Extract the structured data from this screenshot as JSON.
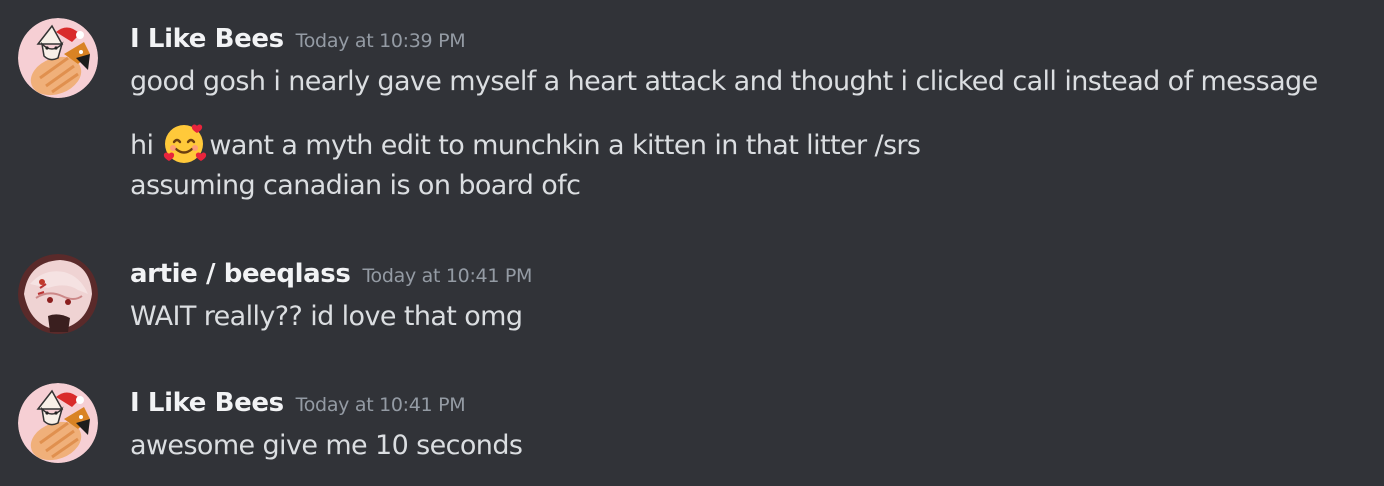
{
  "chat": {
    "messages": [
      {
        "author": "I Like Bees",
        "timestamp": "Today at 10:39 PM",
        "avatar_icon": "fox-with-santa-hat-avatar",
        "lines": [
          "good gosh i nearly gave myself a heart attack and thought i clicked call instead of message",
          "want a myth edit to munchkin a kitten in that litter /srs",
          "assuming canadian is on board ofc"
        ],
        "line2_prefix": "hi",
        "emoji": "smiling-face-with-hearts-emoji"
      },
      {
        "author": "artie / beeqlass",
        "timestamp": "Today at 10:41 PM",
        "avatar_icon": "anime-character-avatar",
        "lines": [
          "WAIT really?? id love that omg"
        ]
      },
      {
        "author": "I Like Bees",
        "timestamp": "Today at 10:41 PM",
        "avatar_icon": "fox-with-santa-hat-avatar",
        "lines": [
          "awesome give me 10 seconds"
        ]
      }
    ]
  },
  "colors": {
    "background": "#313338",
    "username": "#f2f3f5",
    "timestamp": "#949ba4",
    "message_text": "#dbdee1"
  }
}
